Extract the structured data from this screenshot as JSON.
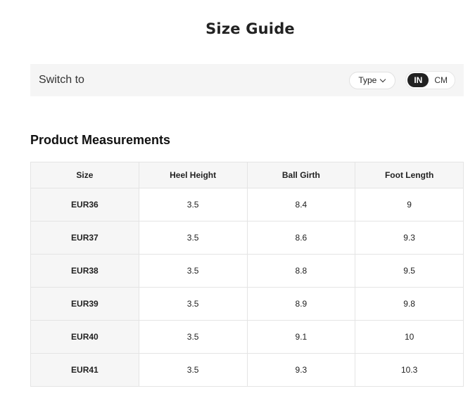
{
  "page": {
    "title": "Size Guide"
  },
  "switch_bar": {
    "label": "Switch to",
    "type_select": {
      "label": "Type",
      "icon": "chevron-down-icon"
    },
    "units": [
      {
        "label": "IN",
        "active": true
      },
      {
        "label": "CM",
        "active": false
      }
    ]
  },
  "measurements": {
    "title": "Product Measurements",
    "headers": [
      "Size",
      "Heel Height",
      "Ball Girth",
      "Foot Length"
    ],
    "rows": [
      [
        "EUR36",
        "3.5",
        "8.4",
        "9"
      ],
      [
        "EUR37",
        "3.5",
        "8.6",
        "9.3"
      ],
      [
        "EUR38",
        "3.5",
        "8.8",
        "9.5"
      ],
      [
        "EUR39",
        "3.5",
        "8.9",
        "9.8"
      ],
      [
        "EUR40",
        "3.5",
        "9.1",
        "10"
      ],
      [
        "EUR41",
        "3.5",
        "9.3",
        "10.3"
      ]
    ]
  }
}
